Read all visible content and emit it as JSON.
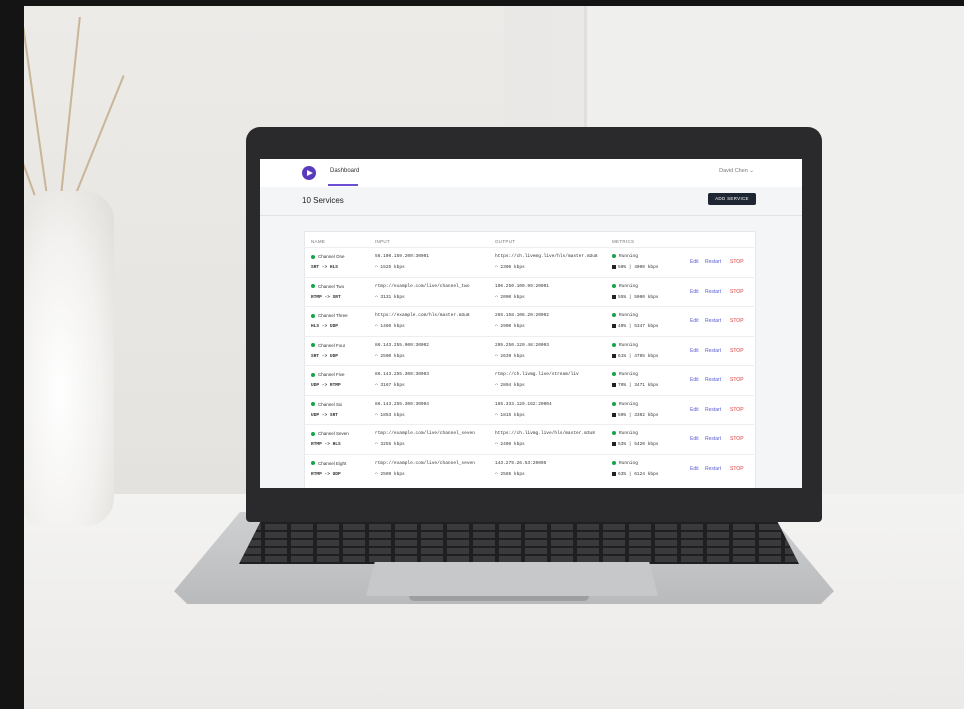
{
  "app": {
    "nav_tab": "Dashboard",
    "user_menu": "David Chen",
    "user_menu_chevron": "⌄",
    "page_title": "10 Services",
    "add_button": "ADD SERVICE"
  },
  "table": {
    "headers": {
      "name": "NAME",
      "input": "INPUT",
      "output": "OUTPUT",
      "metrics": "METRICS"
    },
    "rows": [
      {
        "name": "Channel One",
        "proto": "SRT -> HLS",
        "input": "56.100.159.200:30001",
        "input_rate": "1525 kbps",
        "output": "https://ch.livemg.live/hls/master.m3u8",
        "output_rate": "2306 kbps",
        "status": "Running",
        "metrics": "50% | 4000 kbps",
        "edit": "Edit",
        "restart": "Restart",
        "stop": "STOP"
      },
      {
        "name": "Channel Two",
        "proto": "RTMP -> SRT",
        "input": "rtmp://example.com/live/channel_two",
        "input_rate": "3131 kbps",
        "output": "106.250.100.99:20001",
        "output_rate": "2000 kbps",
        "status": "Running",
        "metrics": "55% | 5000 kbps",
        "edit": "Edit",
        "restart": "Restart",
        "stop": "STOP"
      },
      {
        "name": "Channel Three",
        "proto": "HLS -> UDP",
        "input": "https://example.com/hls/master.m3u8",
        "input_rate": "1460 kbps",
        "output": "265.158.108.20:20002",
        "output_rate": "2900 kbps",
        "status": "Running",
        "metrics": "40% | 5347 kbps",
        "edit": "Edit",
        "restart": "Restart",
        "stop": "STOP"
      },
      {
        "name": "Channel Four",
        "proto": "SRT -> UDP",
        "input": "86.143.255.900:30002",
        "input_rate": "2500 kbps",
        "output": "205.250.120.48:20003",
        "output_rate": "2639 kbps",
        "status": "Running",
        "metrics": "61% | 4705 kbps",
        "edit": "Edit",
        "restart": "Restart",
        "stop": "STOP"
      },
      {
        "name": "Channel Five",
        "proto": "UDP -> RTMP",
        "input": "86.143.255.300:30003",
        "input_rate": "3167 kbps",
        "output": "rtmp://ch.livmg.live/stream/liv",
        "output_rate": "2804 kbps",
        "status": "Running",
        "metrics": "70% | 3471 kbps",
        "edit": "Edit",
        "restart": "Restart",
        "stop": "STOP"
      },
      {
        "name": "Channel Six",
        "proto": "UDP -> SRT",
        "input": "86.143.255.300:30004",
        "input_rate": "1853 kbps",
        "output": "165.333.129.162:20004",
        "output_rate": "1815 kbps",
        "status": "Running",
        "metrics": "50% | 3302 kbps",
        "edit": "Edit",
        "restart": "Restart",
        "stop": "STOP"
      },
      {
        "name": "Channel Seven",
        "proto": "RTMP -> HLS",
        "input": "rtmp://example.com/live/channel_seven",
        "input_rate": "3255 kbps",
        "output": "https://ch.livmg.live/hls/master.m3u8",
        "output_rate": "2406 kbps",
        "status": "Running",
        "metrics": "53% | 5420 kbps",
        "edit": "Edit",
        "restart": "Restart",
        "stop": "STOP"
      },
      {
        "name": "Channel Eight",
        "proto": "RTMP -> UDP",
        "input": "rtmp://example.com/live/channel_seven",
        "input_rate": "2509 kbps",
        "output": "143.279.26.53:20005",
        "output_rate": "2585 kbps",
        "status": "Running",
        "metrics": "63% | 6124 kbps",
        "edit": "Edit",
        "restart": "Restart",
        "stop": "STOP"
      }
    ]
  }
}
